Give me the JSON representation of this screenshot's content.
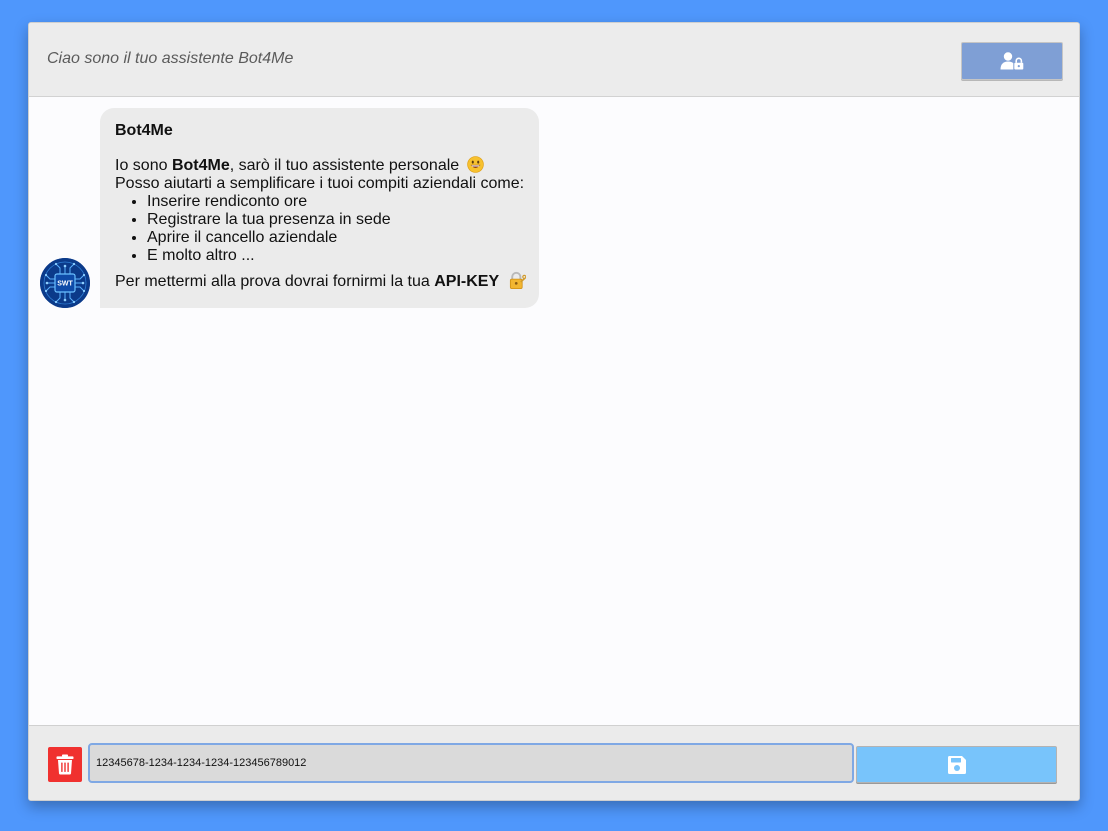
{
  "header": {
    "title": "Ciao sono il tuo assistente Bot4Me",
    "login_icon": "user-lock-icon"
  },
  "chat": {
    "avatar_label": "SWT",
    "messages": [
      {
        "sender": "Bot4Me",
        "intro_prefix": "Io sono ",
        "intro_bold": "Bot4Me",
        "intro_suffix": ", sarò il tuo assistente personale",
        "intro_emoji": "grinning-face-emoji",
        "line2": "Posso aiutarti a semplificare i tuoi compiti aziendali come:",
        "items": [
          "Inserire rendiconto ore",
          "Registrare la tua presenza in sede",
          "Aprire il cancello aziendale",
          "E molto altro ..."
        ],
        "closing_prefix": "Per mettermi alla prova dovrai fornirmi la tua ",
        "closing_bold": "API-KEY",
        "closing_emoji": "locked-with-key-emoji"
      }
    ]
  },
  "footer": {
    "delete_icon": "trash-icon",
    "api_key_value": "12345678-1234-1234-1234-123456789012",
    "save_icon": "floppy-disk-icon"
  },
  "colors": {
    "background": "#4f97fc",
    "login_button": "#7f9fd5",
    "delete_button": "#f0312f",
    "save_button": "#78c4fb",
    "bubble": "#ebebeb"
  }
}
